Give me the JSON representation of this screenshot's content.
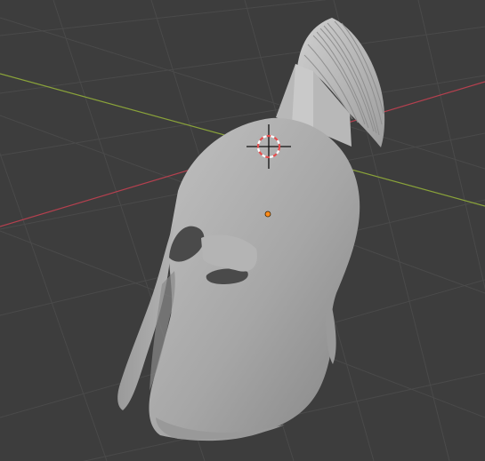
{
  "viewport": {
    "background": "#3d3d3d",
    "grid_color": "#4a4a4a",
    "x_axis_color": "#b5404f",
    "y_axis_color": "#8aa33a"
  },
  "scene": {
    "object": "helmet",
    "mesh_color": "#a8a8a8",
    "mesh_shadow": "#8a8a8a",
    "crest_color": "#bdbdbd",
    "crest_strand_color": "#8c8c8c",
    "origin_color": "#ff8c1a"
  },
  "gizmos": {
    "cursor_icon": "3d-cursor-icon",
    "origin_icon": "object-origin-dot-icon"
  }
}
